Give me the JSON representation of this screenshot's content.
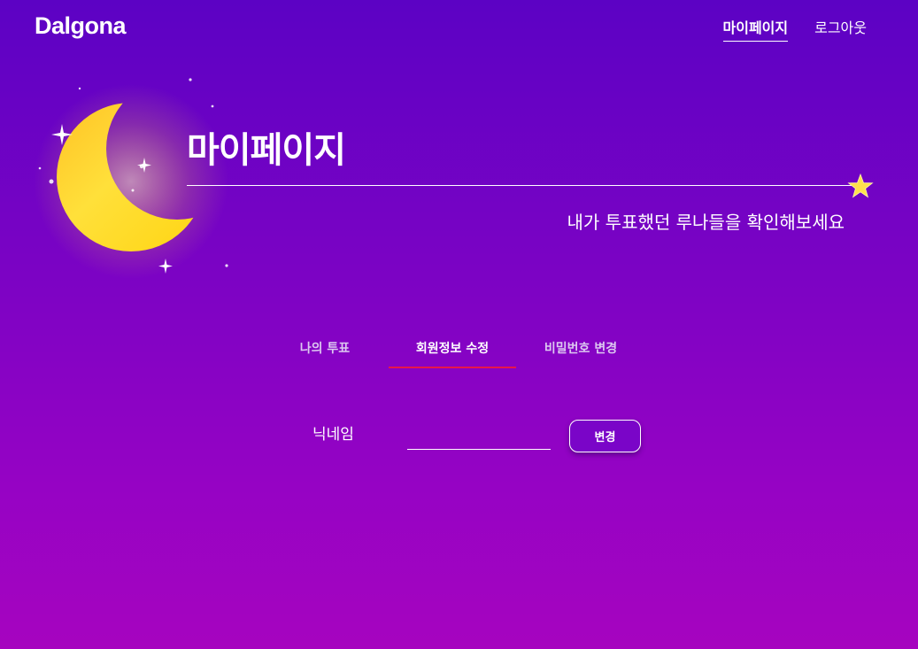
{
  "header": {
    "logo": "Dalgona",
    "nav": [
      {
        "label": "마이페이지",
        "active": true
      },
      {
        "label": "로그아웃",
        "active": false
      }
    ]
  },
  "hero": {
    "title": "마이페이지",
    "subtitle": "내가 투표했던 루나들을 확인해보세요",
    "art_icon": "crescent-moon-icon",
    "rule_icon": "star-icon"
  },
  "tabs": [
    {
      "label": "나의 투표",
      "active": false
    },
    {
      "label": "회원정보 수정",
      "active": true
    },
    {
      "label": "비밀번호 변경",
      "active": false
    }
  ],
  "form": {
    "nickname_label": "닉네임",
    "nickname_value": "",
    "nickname_placeholder": "",
    "submit_label": "변경"
  },
  "colors": {
    "background_top": "#5c02c4",
    "background_bottom": "#a604bf",
    "active_tab_underline": "#e8174a",
    "moon": "#ffd21a",
    "star": "#ffe14d"
  }
}
